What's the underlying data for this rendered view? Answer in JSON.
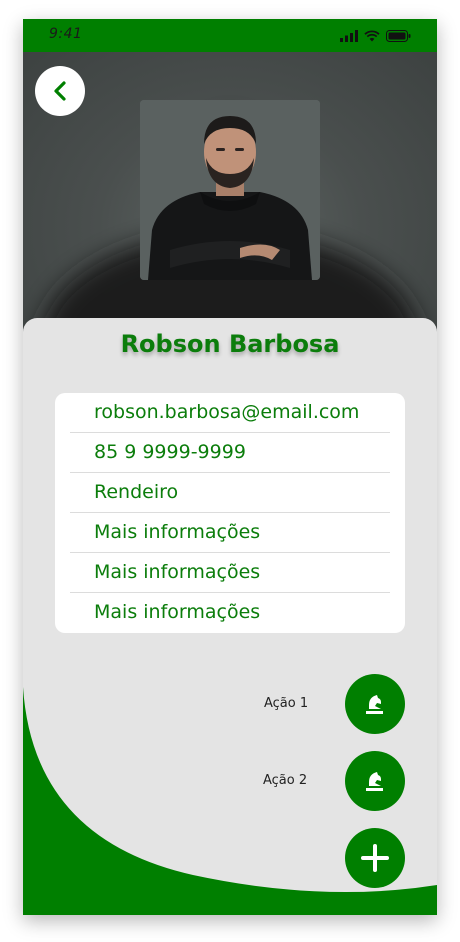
{
  "status_bar": {
    "time": "9:41"
  },
  "profile": {
    "name": "Robson Barbosa"
  },
  "info_items": [
    "robson.barbosa@email.com",
    "85 9 9999-9999",
    "Rendeiro",
    "Mais informações",
    "Mais informações",
    "Mais informações"
  ],
  "actions": [
    {
      "label": "Ação 1",
      "icon": "chess-knight-icon"
    },
    {
      "label": "Ação 2",
      "icon": "chess-knight-icon"
    }
  ],
  "fab": {
    "icon": "plus-icon"
  },
  "colors": {
    "accent": "#007f00",
    "text_green": "#0b7d0b",
    "card_bg": "#e4e4e4"
  }
}
